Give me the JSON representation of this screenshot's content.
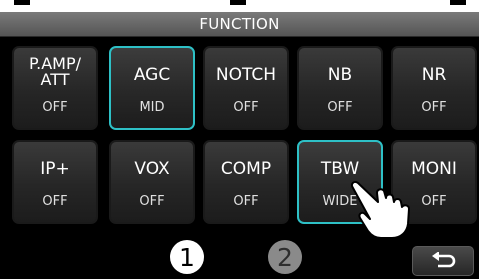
{
  "title": "FUNCTION",
  "buttons": [
    {
      "label": "P.AMP/\nATT",
      "value": "OFF",
      "active": false
    },
    {
      "label": "AGC",
      "value": "MID",
      "active": true
    },
    {
      "label": "NOTCH",
      "value": "OFF",
      "active": false
    },
    {
      "label": "NB",
      "value": "OFF",
      "active": false
    },
    {
      "label": "NR",
      "value": "OFF",
      "active": false
    },
    {
      "label": "IP+",
      "value": "OFF",
      "active": false
    },
    {
      "label": "VOX",
      "value": "OFF",
      "active": false
    },
    {
      "label": "COMP",
      "value": "OFF",
      "active": false
    },
    {
      "label": "TBW",
      "value": "WIDE",
      "active": true
    },
    {
      "label": "MONI",
      "value": "OFF",
      "active": false
    }
  ],
  "pages": [
    "1",
    "2"
  ],
  "current_page": 1,
  "icons": {
    "back": "return-arrow-icon",
    "pointer": "hand-pointer-icon"
  },
  "colors": {
    "highlight": "#2ec0c6",
    "background": "#000000",
    "title_bar": "#666666"
  }
}
